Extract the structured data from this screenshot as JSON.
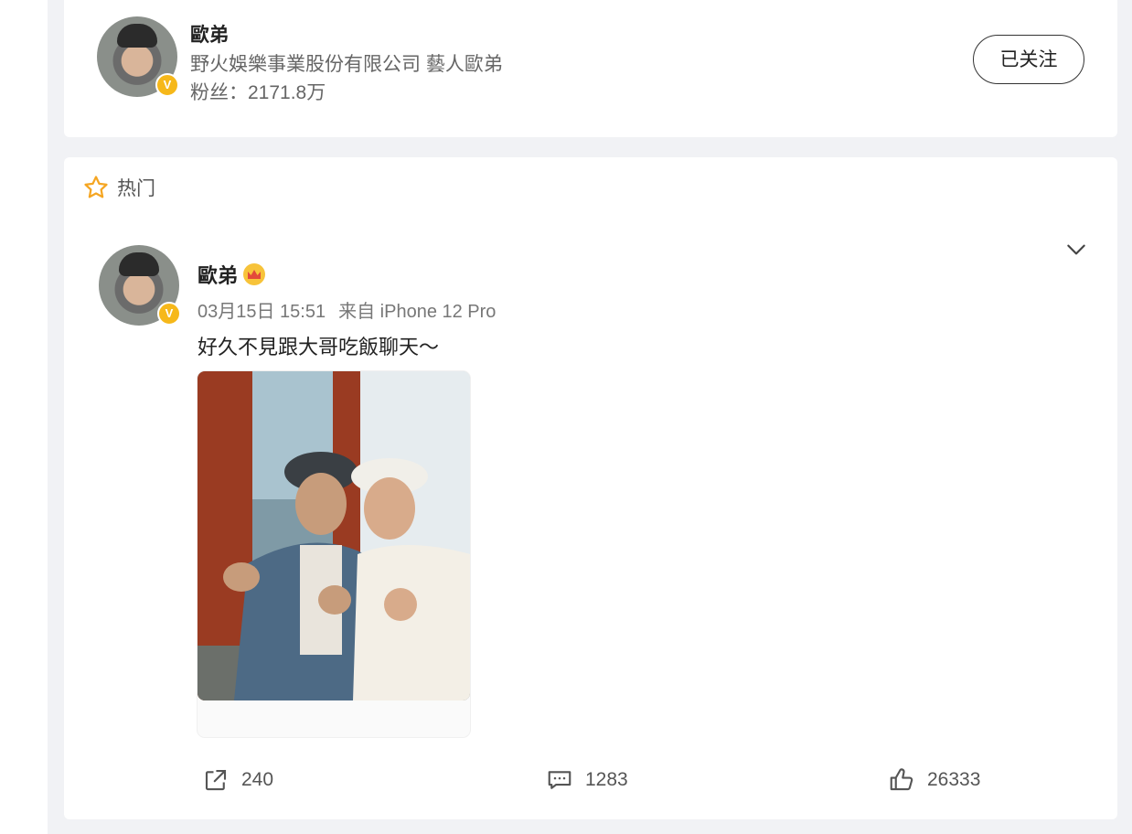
{
  "profile": {
    "name": "歐弟",
    "description": "野火娛樂事業股份有限公司 藝人歐弟",
    "fans_label": "粉丝：",
    "fans_value": "2171.8万",
    "follow_label": "已关注"
  },
  "feed": {
    "section_label": "热门",
    "post": {
      "author": "歐弟",
      "date": "03月15日 15:51",
      "source": "来自 iPhone 12 Pro",
      "text": "好久不見跟大哥吃飯聊天～",
      "actions": {
        "share_count": "240",
        "comment_count": "1283",
        "like_count": "26333"
      }
    }
  },
  "colors": {
    "verified_badge": "#f6b81a",
    "page_background": "#f1f2f5",
    "card_background": "#ffffff"
  },
  "icons": [
    "star-icon",
    "chevron-down-icon",
    "share-icon",
    "comment-icon",
    "like-icon",
    "verified-icon",
    "crown-icon"
  ]
}
